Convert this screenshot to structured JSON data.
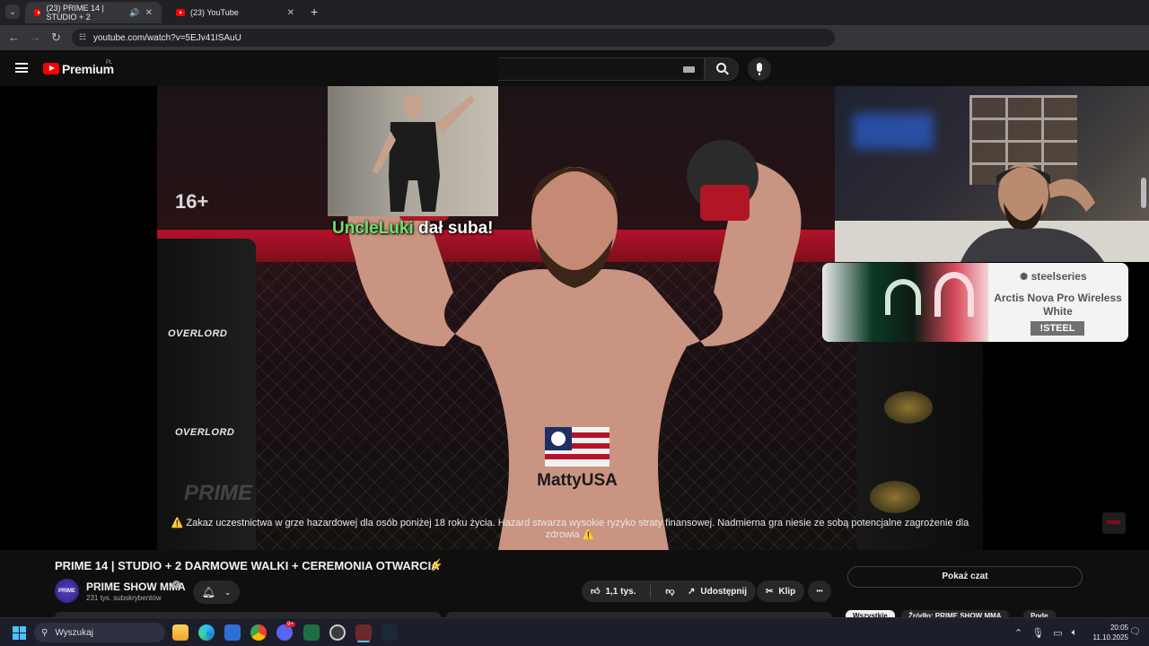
{
  "browser": {
    "tabs": [
      {
        "label": "(23) PRIME 14 | STUDIO + 2",
        "active": true,
        "audio_icon": "speaker-icon"
      },
      {
        "label": "(23) YouTube",
        "active": false
      }
    ],
    "new_tab_label": "+",
    "url": "youtube.com/watch?v=5EJv41ISAuU"
  },
  "youtube": {
    "logo_text": "Premium",
    "logo_region": "PL"
  },
  "player": {
    "age_rating": "16+",
    "disclaimer": "⚠️ Zakaz uczestnictwa w grze hazardowej dla osób poniżej 18 roku życia. Hazard stwarza wysokie ryzyko straty finansowej. Nadmierna gra niesie ze sobą potencjalne zagrożenie dla zdrowia ⚠️",
    "cage_brand": "OVERLORD",
    "watermark": "PRIME",
    "corner_logo": "PRIME",
    "sponsor_text": "MattyUSA"
  },
  "stream_overlay": {
    "sub_name": "UncleLuki",
    "sub_text": "dał suba!",
    "ad": {
      "brand": "steelseries",
      "title": "Arctis Nova Pro Wireless White",
      "promo": "!STEEL"
    }
  },
  "video": {
    "title": "PRIME 14 | STUDIO + 2 DARMOWE WALKI + CEREMONIA OTWARCIA",
    "channel": "PRIME SHOW MMA",
    "channel_avatar_text": "PRIME",
    "subscribers": "231 tys. subskrybentów",
    "likes": "1,1 tys.",
    "share_label": "Udostępnij",
    "clip_label": "Klip",
    "more_label": "•••"
  },
  "chat": {
    "show_chat_label": "Pokaż czat",
    "chips": [
      "Wszystkie",
      "Źródło: PRIME SHOW MMA",
      "Pode"
    ]
  },
  "taskbar": {
    "search_placeholder": "Wyszukaj",
    "time": "20:05",
    "date": "11.10.2025",
    "discord_badge": "9+"
  },
  "colors": {
    "accent_red": "#ff0000",
    "sub_name_green": "#6be26b",
    "taskbar_bg": "#1c1f2b",
    "windows_blue": "#4cc2ff"
  }
}
